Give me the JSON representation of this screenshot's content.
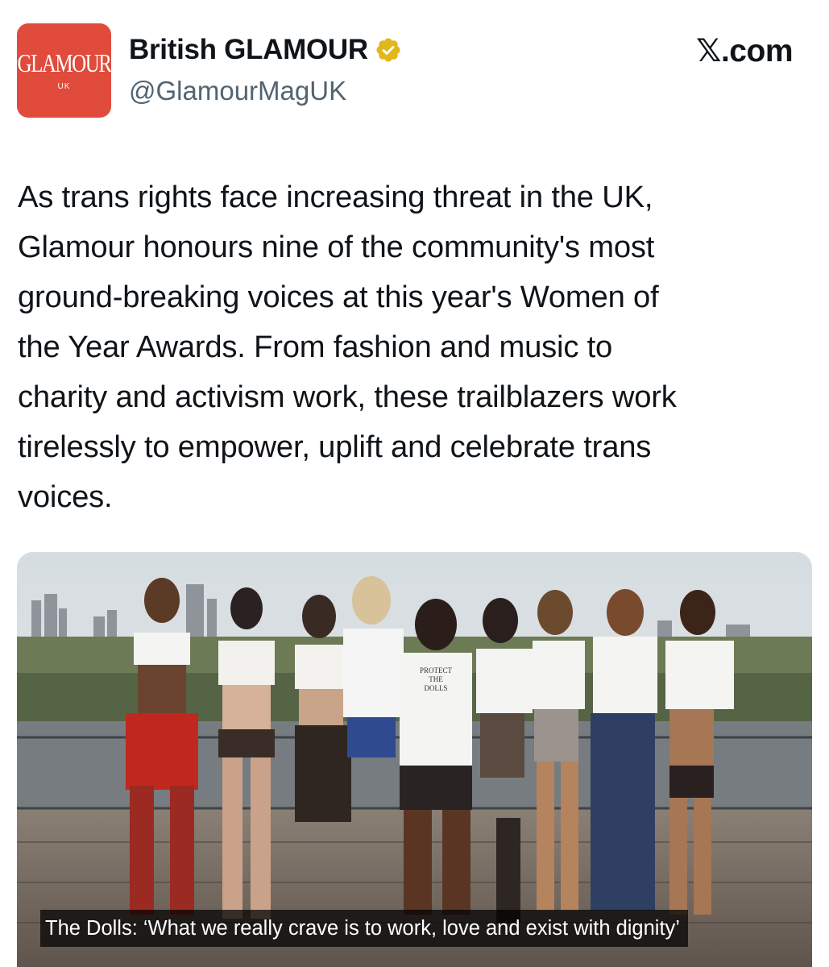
{
  "account": {
    "avatar_brand": "GLAMOUR",
    "avatar_sub": "UK",
    "display_name": "British GLAMOUR",
    "handle": "@GlamourMagUK",
    "verified_color": "#e2b719",
    "avatar_color": "#e04b3c"
  },
  "header": {
    "site": "𝕏.com"
  },
  "tweet": {
    "text": "As trans rights face increasing threat in the UK,\nGlamour honours nine of the community's most\nground-breaking voices at this year's Women of\nthe Year Awards. From fashion and music to\ncharity and activism work, these trailblazers work\ntirelessly to empower, uplift and celebrate trans\nvoices."
  },
  "media": {
    "caption": "The Dolls: ‘What we really crave is to work, love and exist with dignity’",
    "shirt_text": [
      "PROTECT",
      "THE",
      "DOLLS"
    ]
  }
}
